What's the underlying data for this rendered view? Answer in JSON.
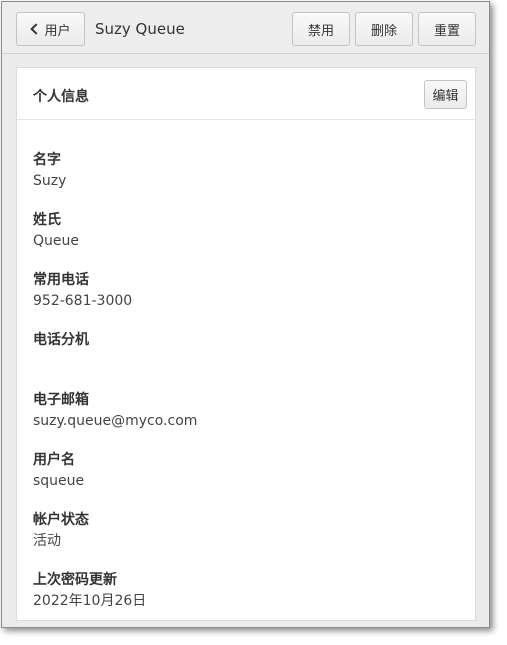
{
  "toolbar": {
    "back_label": "用户",
    "title": "Suzy Queue",
    "disable_label": "禁用",
    "delete_label": "删除",
    "reset_label": "重置"
  },
  "panel": {
    "title": "个人信息",
    "edit_label": "编辑"
  },
  "fields": [
    {
      "label": "名字",
      "value": "Suzy"
    },
    {
      "label": "姓氏",
      "value": "Queue"
    },
    {
      "label": "常用电话",
      "value": "952-681-3000"
    },
    {
      "label": "电话分机",
      "value": ""
    },
    {
      "label": "电子邮箱",
      "value": "suzy.queue@myco.com"
    },
    {
      "label": "用户名",
      "value": "squeue"
    },
    {
      "label": "帐户状态",
      "value": "活动"
    },
    {
      "label": "上次密码更新",
      "value": "2022年10月26日"
    }
  ]
}
